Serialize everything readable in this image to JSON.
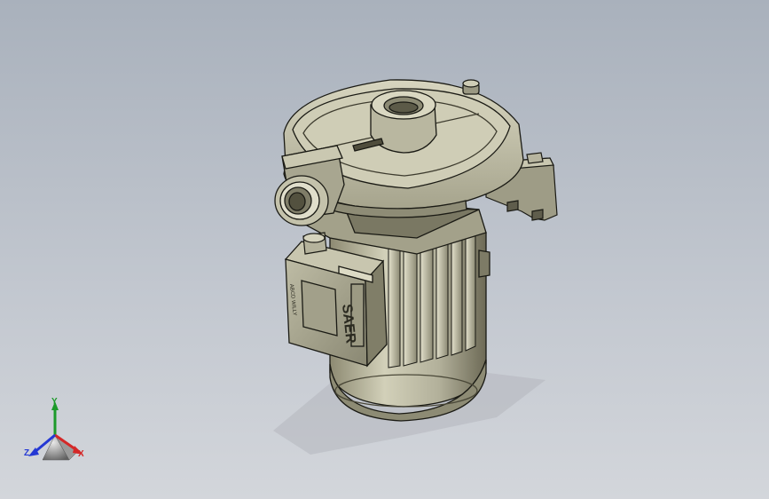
{
  "viewport": {
    "background_top": "#a9b1bc",
    "background_bottom": "#d3d6db"
  },
  "model": {
    "icon": "pump-motor-icon",
    "nameplate": {
      "brand": "SAER",
      "side_text": "ABCD WILLY"
    },
    "colors": {
      "body": "#c5c3ac",
      "body_dark": "#77745f",
      "outline": "#1a1a14"
    }
  },
  "triad": {
    "x_label": "X",
    "y_label": "Y",
    "z_label": "Z",
    "x_color": "#d42828",
    "y_color": "#1c9a2a",
    "z_color": "#2438d4"
  }
}
